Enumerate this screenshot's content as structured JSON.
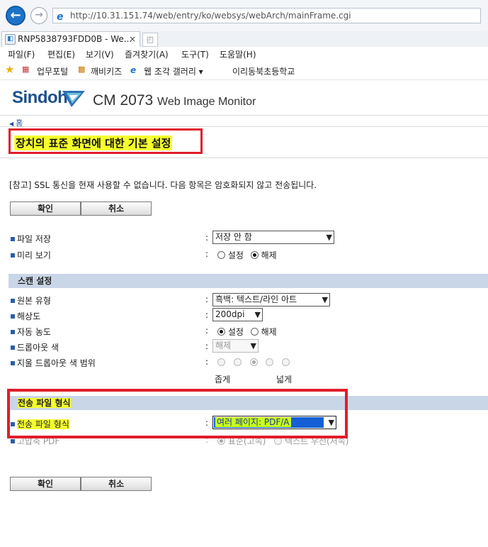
{
  "browser": {
    "back_icon": "back-arrow-icon",
    "forward_icon": "forward-arrow-icon",
    "url": "http://10.31.151.74/web/entry/ko/websys/webArch/mainFrame.cgi",
    "tab_title": "RNP5838793FDD0B - We...",
    "tab_close": "×",
    "menu": [
      "파일(F)",
      "편집(E)",
      "보기(V)",
      "즐겨찾기(A)",
      "도구(T)",
      "도움말(H)"
    ],
    "favorites": [
      "업무포털",
      "깨비키즈",
      "웹 조각 갤러리 ▾",
      "이리동북초등학교"
    ]
  },
  "header": {
    "brand": "Sindoh",
    "model": "CM 2073",
    "product": "Web Image Monitor",
    "breadcrumb": "홈"
  },
  "page": {
    "title": "장치의 표준 화면에 대한 기본 설정",
    "note": "[참고] SSL 통신을 현재 사용할 수 없습니다. 다음 항목은 암호화되지 않고 전송됩니다.",
    "ok_label": "확인",
    "cancel_label": "취소"
  },
  "settings": {
    "file_save": {
      "label": "파일 저장",
      "value": "저장 안 함"
    },
    "preview": {
      "label": "미리 보기",
      "opt_on": "설정",
      "opt_off": "해제",
      "selected": "해제"
    }
  },
  "scan": {
    "section_title": "스캔 설정",
    "original_type": {
      "label": "원본 유형",
      "value": "흑백: 텍스트/라인 아트"
    },
    "resolution": {
      "label": "해상도",
      "value": "200dpi"
    },
    "auto_density": {
      "label": "자동 농도",
      "opt_on": "설정",
      "opt_off": "해제",
      "selected": "설정"
    },
    "dropout_color": {
      "label": "드롭아웃 색",
      "value": "해제"
    },
    "dropout_range": {
      "label": "지울 드롭아웃 색 범위",
      "narrow": "좁게",
      "wide": "넓게",
      "selected_index": 2
    }
  },
  "transfer": {
    "section_title": "전송 파일 형식",
    "file_format": {
      "label": "전송 파일 형식",
      "value": "여러 페이지: PDF/A"
    },
    "compressed_pdf": {
      "label": "고압축 PDF",
      "opt_standard": "표준(고속)",
      "opt_text": "텍스트 우선(저속)"
    }
  },
  "colors": {
    "accent_red": "#e11d2b",
    "highlight": "#f5ff2e",
    "section_bg": "#c9d6e7",
    "selected_blue": "#1560d6"
  }
}
